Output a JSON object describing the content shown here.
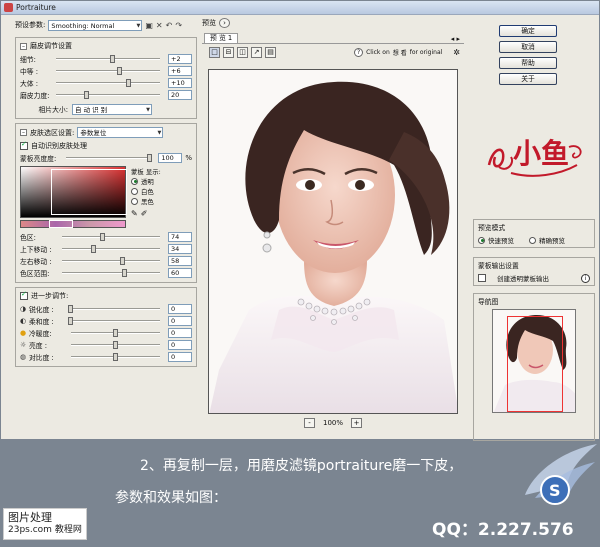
{
  "window": {
    "title": "Portraiture"
  },
  "preset": {
    "label": "预设参数:",
    "value": "Smoothing: Normal"
  },
  "smoothing": {
    "title": "磨皮调节设置",
    "rows": [
      {
        "label": "细节:",
        "value": "+2",
        "level": 0.55
      },
      {
        "label": "中等 :",
        "value": "+6",
        "level": 0.62
      },
      {
        "label": "大体 :",
        "value": "+10",
        "level": 0.7
      },
      {
        "label": "磨皮力度:",
        "value": "20",
        "level": 0.3
      }
    ],
    "size_label": "相片大小:",
    "size_value": "自 动 识 别"
  },
  "skin": {
    "title": "皮肤选区设置:",
    "mode_value": "参数复位",
    "auto_label": "自动识别皮肤处理",
    "mask_label": "蒙板亮度度:",
    "mask_value": "100",
    "mask_unit": "%",
    "mask_level": 1.0,
    "display_label": "蒙板 显示:",
    "display_options": [
      "透明",
      "白色",
      "黑色"
    ],
    "rows": [
      {
        "label": "色区:",
        "value": "74",
        "level": 0.42
      },
      {
        "label": "上下移动 :",
        "value": "34",
        "level": 0.33
      },
      {
        "label": "左右移动 :",
        "value": "58",
        "level": 0.62
      },
      {
        "label": "色区范围:",
        "value": "60",
        "level": 0.64
      }
    ]
  },
  "enhance": {
    "title": "进一步调节:",
    "rows": [
      {
        "label": "锐化度 :",
        "value": "0",
        "level": 0.0
      },
      {
        "label": "柔和度 :",
        "value": "0",
        "level": 0.0
      },
      {
        "label": "冷暖度:",
        "value": "0",
        "level": 0.5
      },
      {
        "label": "亮度 :",
        "value": "0",
        "level": 0.5
      },
      {
        "label": "对比度 :",
        "value": "0",
        "level": 0.5
      }
    ]
  },
  "preview": {
    "label": "预览",
    "tab": "预 览 1",
    "hint_prefix": "Click on",
    "hint_mid": "想 看",
    "hint_suffix": "for original",
    "zoom": "100%"
  },
  "actions": {
    "ok": "确定",
    "cancel": "取消",
    "help": "帮助",
    "about": "关于"
  },
  "logo_text": "小鱼",
  "preview_mode": {
    "title": "预览模式",
    "options": [
      "快速预览",
      "精确预览"
    ]
  },
  "output": {
    "title": "蒙板输出设置",
    "option": "创建透明蒙板输出"
  },
  "navigator": {
    "title": "导航图"
  },
  "caption": {
    "line1": "2、再复制一层，用磨皮滤镜portraiture磨一下皮，",
    "line2": "参数和效果如图："
  },
  "watermark": {
    "left_title": "图片处理",
    "left_sub": "教程网",
    "left_url": "23ps.com",
    "qq": "QQ：2.227.576"
  }
}
